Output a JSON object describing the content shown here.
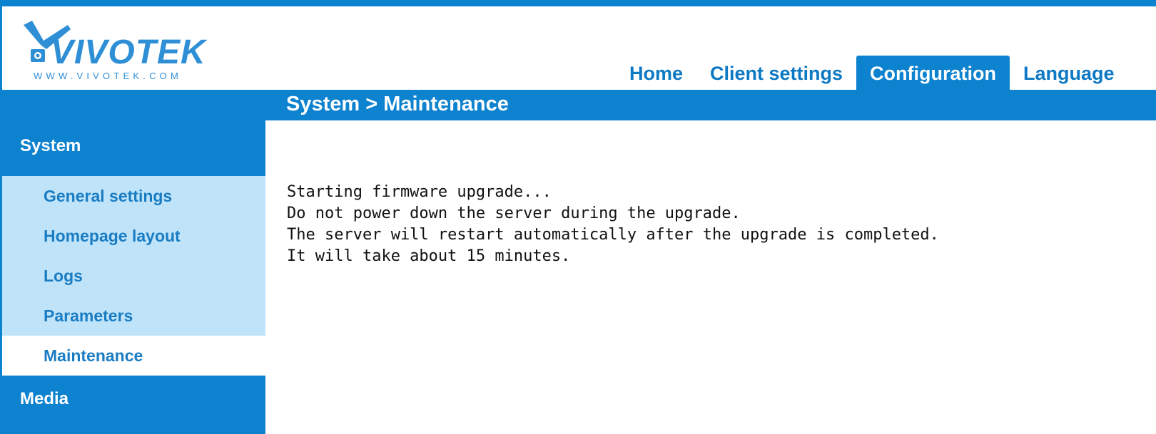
{
  "brand": {
    "logo_text": "VIVOTEK",
    "logo_url_text": "WWW.VIVOTEK.COM"
  },
  "colors": {
    "accent": "#0d82cf",
    "sidebar_light": "#bfe4fa",
    "link": "#1a7cc2"
  },
  "nav": {
    "tabs": [
      {
        "label": "Home",
        "active": false
      },
      {
        "label": "Client settings",
        "active": false
      },
      {
        "label": "Configuration",
        "active": true
      },
      {
        "label": "Language",
        "active": false
      }
    ]
  },
  "breadcrumb": {
    "text": "System  > Maintenance"
  },
  "sidebar": {
    "section_system": "System",
    "items": [
      {
        "label": "General settings"
      },
      {
        "label": "Homepage layout"
      },
      {
        "label": "Logs"
      },
      {
        "label": "Parameters"
      },
      {
        "label": "Maintenance",
        "selected": true
      }
    ],
    "section_media": "Media"
  },
  "main": {
    "lines": [
      "Starting firmware upgrade...",
      "Do not power down the server during the upgrade.",
      "The server will restart automatically after the upgrade is completed.",
      "It will take about 15 minutes."
    ]
  }
}
